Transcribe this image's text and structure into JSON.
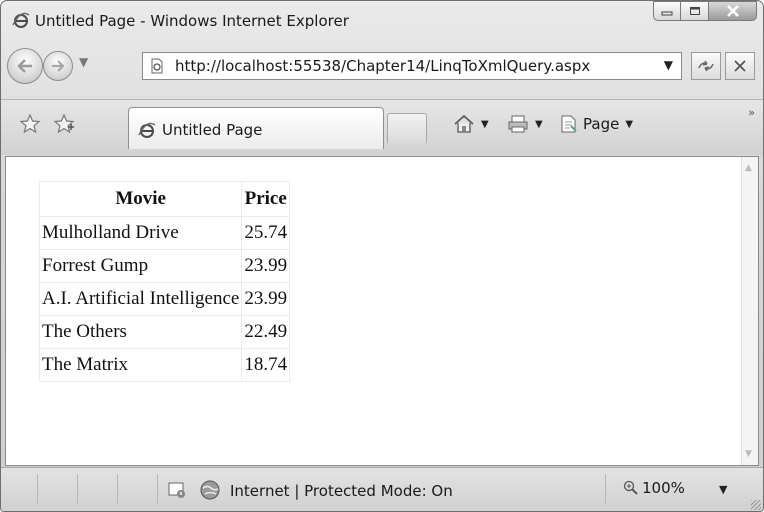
{
  "window": {
    "title": "Untitled Page - Windows Internet Explorer",
    "minimize_icon": "minimize-icon",
    "maximize_icon": "maximize-icon",
    "close_icon": "close-icon"
  },
  "address_bar": {
    "url": "http://localhost:55538/Chapter14/LinqToXmlQuery.aspx"
  },
  "tab": {
    "label": "Untitled Page"
  },
  "command_bar": {
    "page_label": "Page"
  },
  "content": {
    "headers": [
      "Movie",
      "Price"
    ],
    "rows": [
      [
        "Mulholland Drive",
        "25.74"
      ],
      [
        "Forrest Gump",
        "23.99"
      ],
      [
        "A.I. Artificial Intelligence",
        "23.99"
      ],
      [
        "The Others",
        "22.49"
      ],
      [
        "The Matrix",
        "18.74"
      ]
    ]
  },
  "status_bar": {
    "zone": "Internet | Protected Mode: On",
    "zoom": "100%"
  },
  "colors": {
    "frame": "#d6d6d6",
    "content_bg": "#ffffff"
  }
}
